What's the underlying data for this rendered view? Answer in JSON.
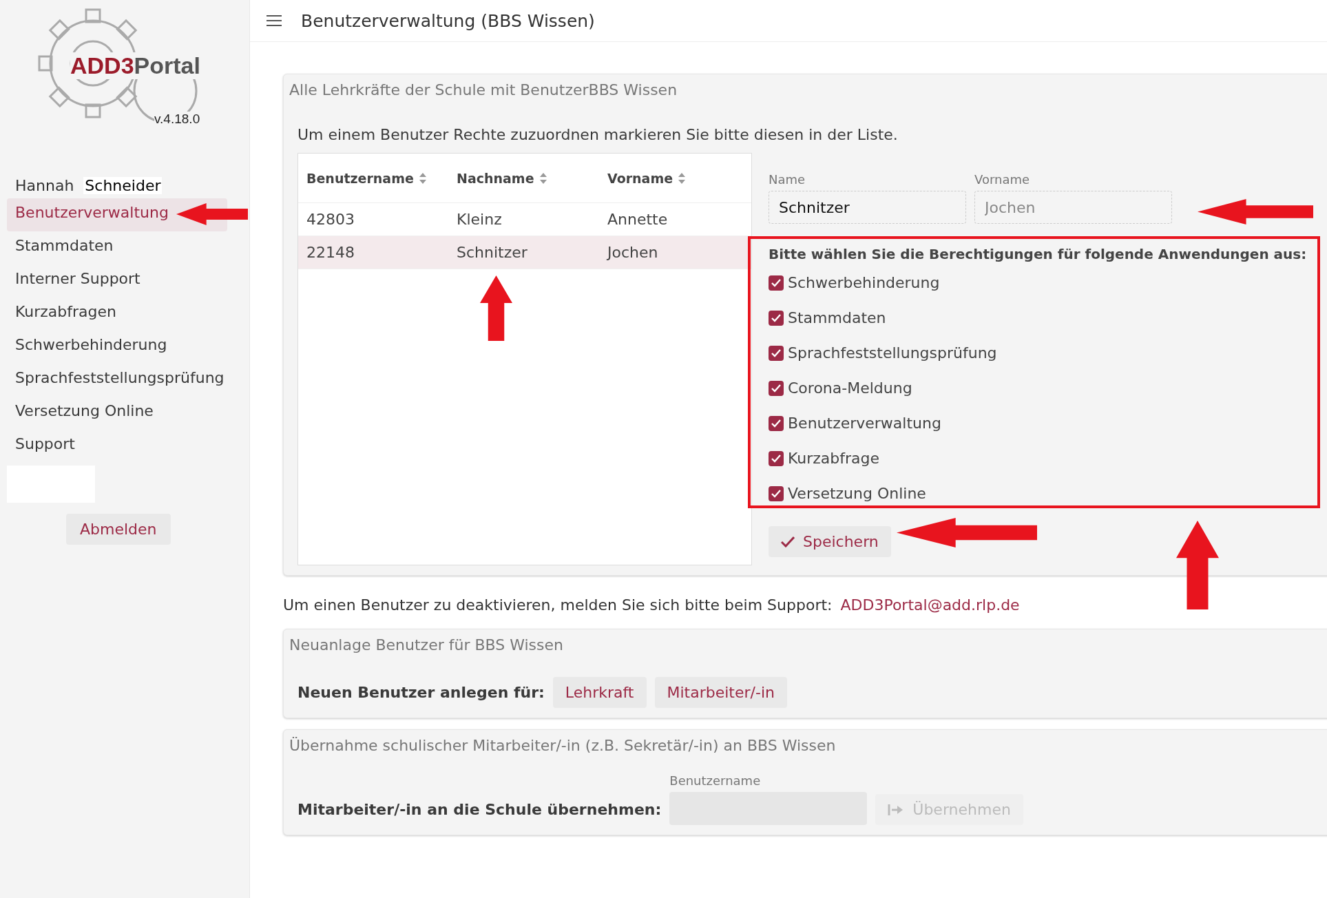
{
  "logo": {
    "brand_first": "ADD3",
    "brand_second": "Portal",
    "version": "v.4.18.0"
  },
  "header": {
    "title": "Benutzerverwaltung (BBS Wissen)"
  },
  "user": {
    "first_name": "Hannah",
    "last_name": "Schneider"
  },
  "sidebar": {
    "items": [
      {
        "label": "Benutzerverwaltung",
        "selected": true
      },
      {
        "label": "Stammdaten",
        "selected": false
      },
      {
        "label": "Interner Support",
        "selected": false
      },
      {
        "label": "Kurzabfragen",
        "selected": false
      },
      {
        "label": "Schwerbehinderung",
        "selected": false
      },
      {
        "label": "Sprachfeststellungsprüfung",
        "selected": false
      },
      {
        "label": "Versetzung Online",
        "selected": false
      },
      {
        "label": "Support",
        "selected": false
      }
    ],
    "logout": "Abmelden"
  },
  "users_panel": {
    "title": "Alle Lehrkräfte der Schule mit BenutzerBBS Wissen",
    "instruction": "Um einem Benutzer Rechte zuzuordnen markieren Sie bitte diesen in der Liste.",
    "table": {
      "columns": [
        "Benutzername",
        "Nachname",
        "Vorname"
      ],
      "rows": [
        {
          "cells": [
            "42803",
            "Kleinz",
            "Annette"
          ],
          "selected": false
        },
        {
          "cells": [
            "22148",
            "Schnitzer",
            "Jochen"
          ],
          "selected": true
        }
      ]
    },
    "form": {
      "name_label": "Name",
      "name_value": "Schnitzer",
      "firstname_label": "Vorname",
      "firstname_value": "Jochen",
      "permissions_heading": "Bitte wählen Sie die Berechtigungen für folgende Anwendungen aus:",
      "permissions": [
        {
          "label": "Schwerbehinderung",
          "checked": true
        },
        {
          "label": "Stammdaten",
          "checked": true
        },
        {
          "label": "Sprachfeststellungsprüfung",
          "checked": true
        },
        {
          "label": "Corona-Meldung",
          "checked": true
        },
        {
          "label": "Benutzerverwaltung",
          "checked": true
        },
        {
          "label": "Kurzabfrage",
          "checked": true
        },
        {
          "label": "Versetzung Online",
          "checked": true
        }
      ],
      "save": "Speichern"
    }
  },
  "support_note": {
    "text": "Um einen Benutzer zu deaktivieren, melden Sie sich bitte beim Support:",
    "email": "ADD3Portal@add.rlp.de"
  },
  "new_user_panel": {
    "title": "Neuanlage Benutzer für BBS Wissen",
    "label": "Neuen Benutzer anlegen für:",
    "buttons": [
      "Lehrkraft",
      "Mitarbeiter/-in"
    ]
  },
  "transfer_panel": {
    "title": "Übernahme schulischer Mitarbeiter/-in (z.B. Sekretär/-in) an BBS Wissen",
    "label": "Mitarbeiter/-in an die Schule übernehmen:",
    "field_label": "Benutzername",
    "button": "Übernehmen",
    "button_disabled": true
  }
}
